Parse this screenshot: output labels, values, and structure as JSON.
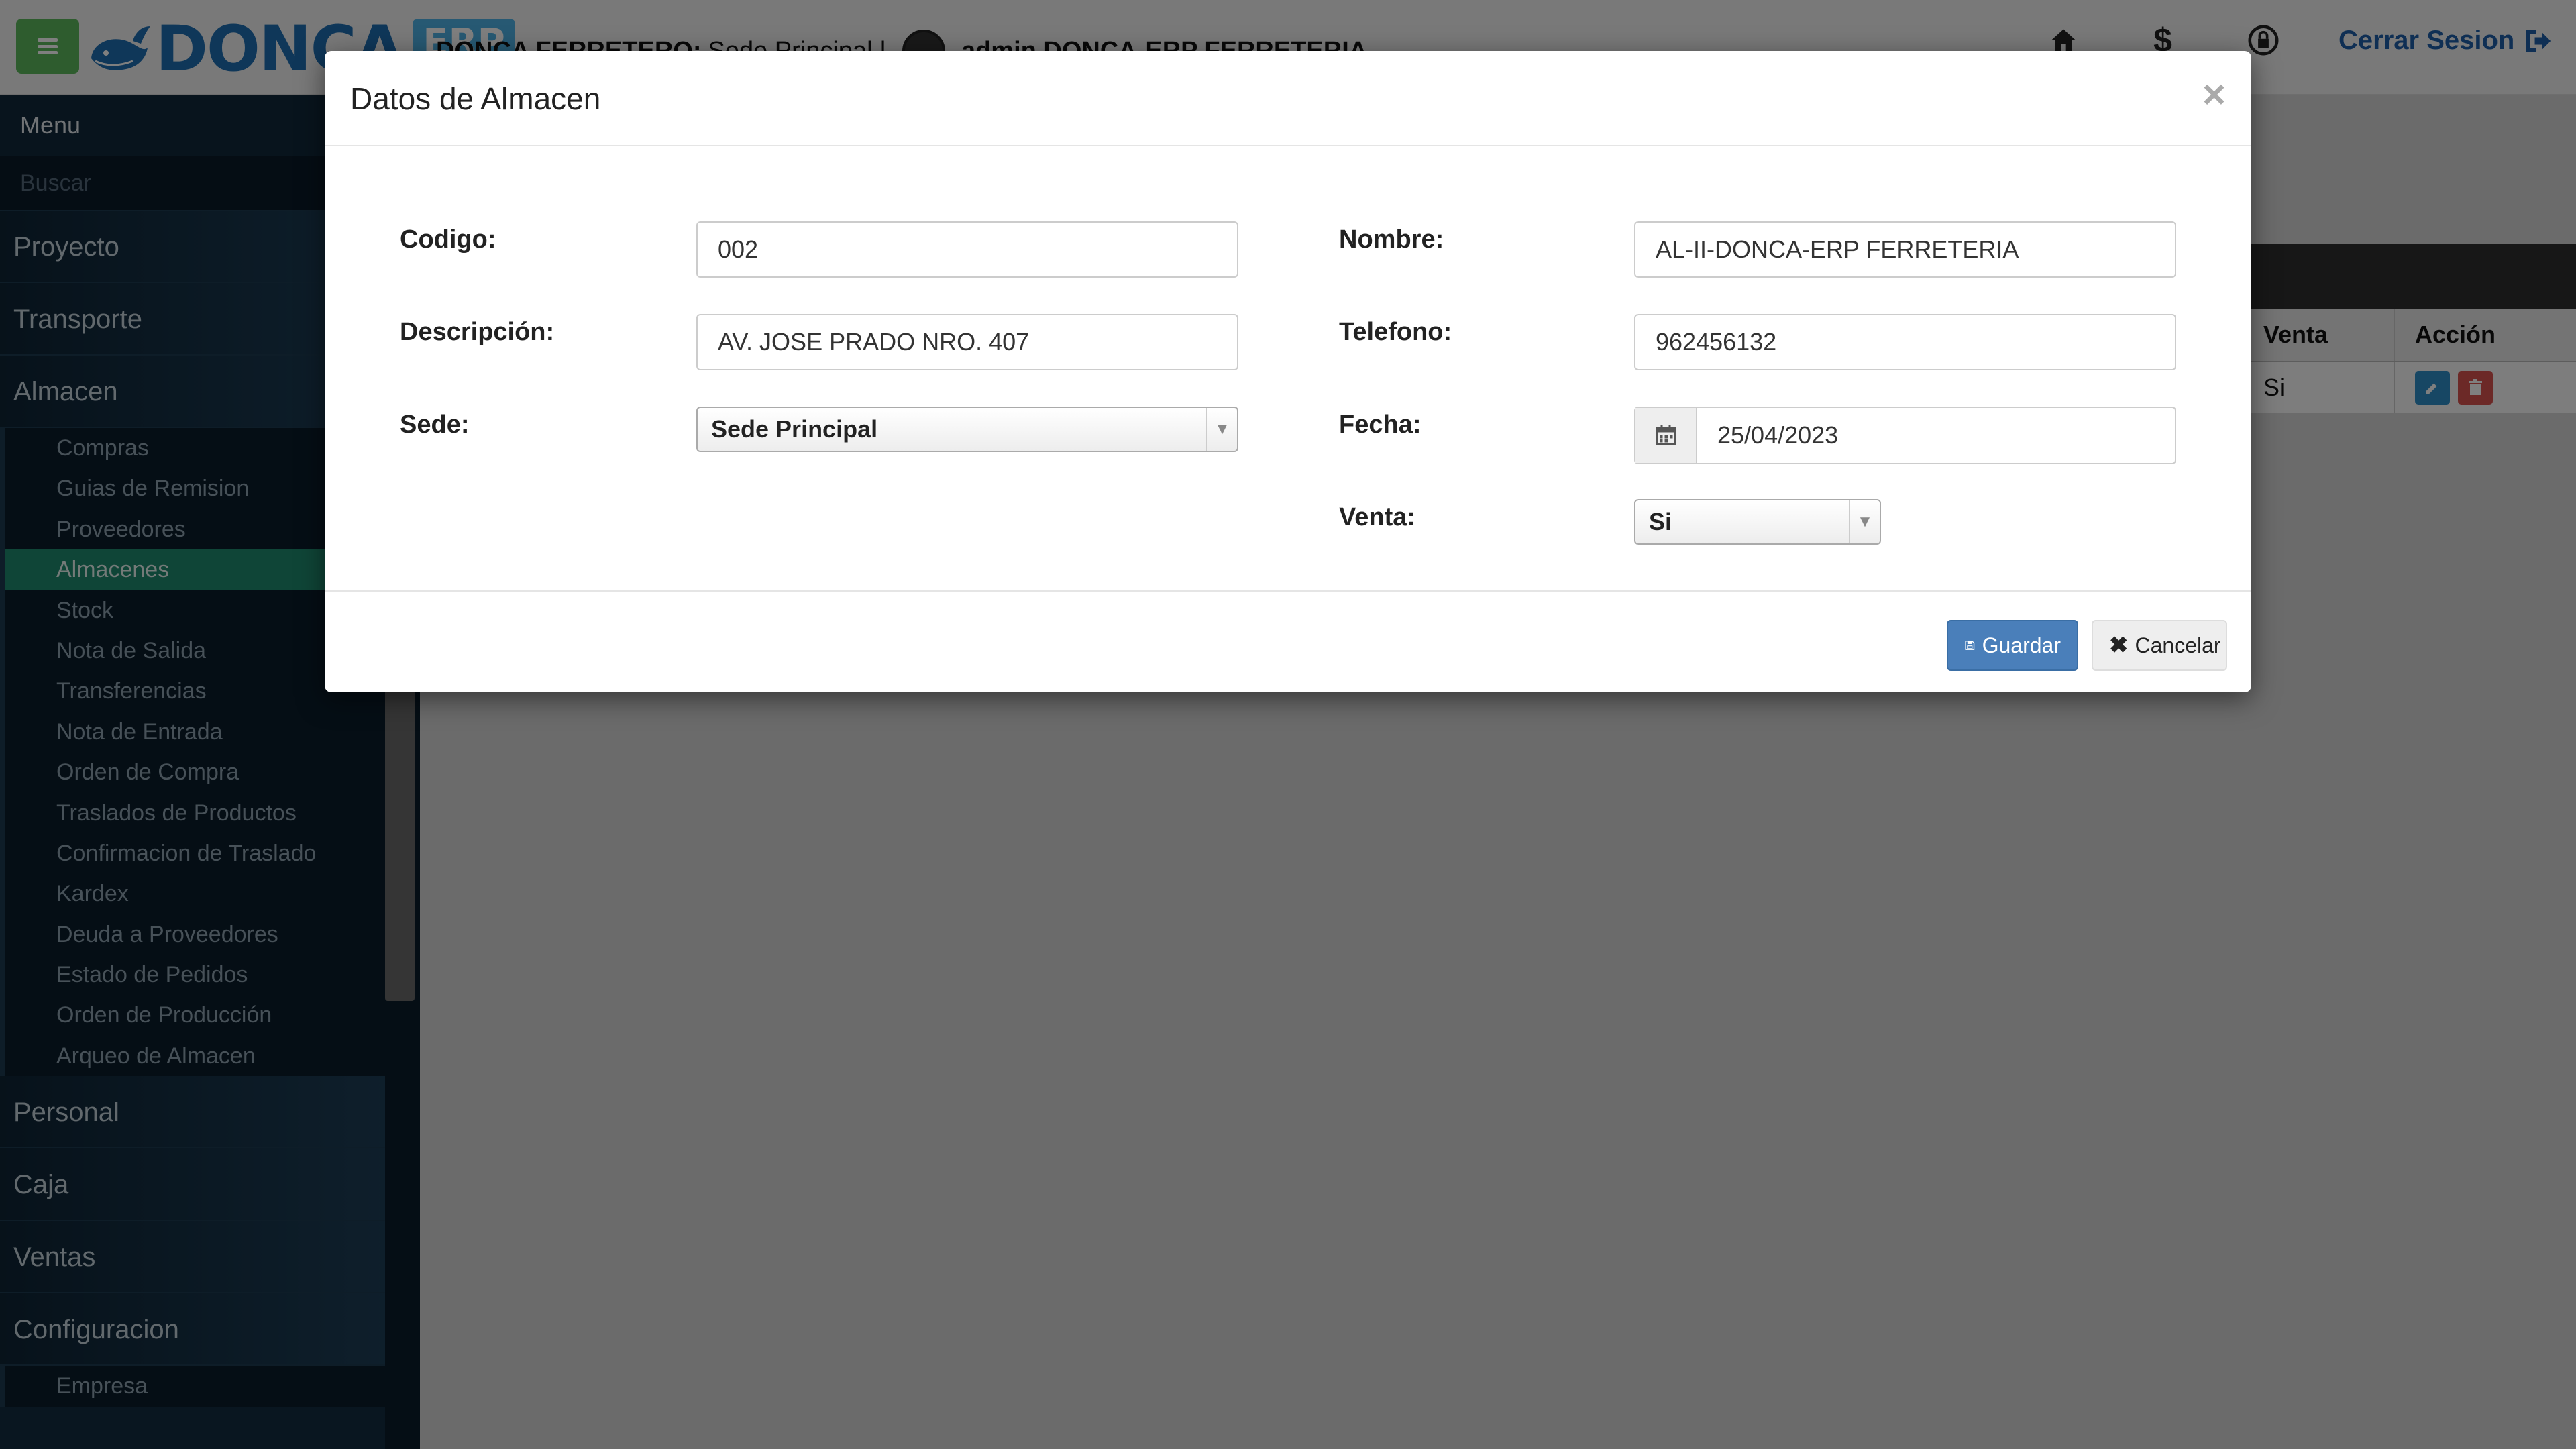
{
  "header": {
    "logo_text": "DONCA",
    "logo_badge": "ERP",
    "company_name": "DONCA FERRETERO:",
    "branch": "Sede Principal |",
    "user": "admin DONCA-ERP FERRETERIA",
    "logout_label": "Cerrar Sesion"
  },
  "sidebar": {
    "title": "Menu",
    "search_placeholder": "Buscar",
    "sections_top": [
      "Proyecto",
      "Transporte",
      "Almacen"
    ],
    "almacen_items": [
      "Compras",
      "Guias de Remision",
      "Proveedores",
      "Almacenes",
      "Stock",
      "Nota de Salida",
      "Transferencias",
      "Nota de Entrada",
      "Orden de Compra",
      "Traslados de Productos",
      "Confirmacion de Traslado",
      "Kardex",
      "Deuda a Proveedores",
      "Estado de Pedidos",
      "Orden de Producción",
      "Arqueo de Almacen"
    ],
    "active_item": "Almacenes",
    "sections_bottom": [
      "Personal",
      "Caja",
      "Ventas",
      "Configuracion"
    ],
    "config_items": [
      "Empresa"
    ]
  },
  "table": {
    "headers": [
      "Venta",
      "Acción"
    ],
    "row": {
      "venta": "Si"
    }
  },
  "modal": {
    "title": "Datos de Almacen",
    "fields": {
      "codigo_label": "Codigo:",
      "codigo_value": "002",
      "nombre_label": "Nombre:",
      "nombre_value": "AL-II-DONCA-ERP FERRETERIA",
      "descripcion_label": "Descripción:",
      "descripcion_value": "AV. JOSE PRADO NRO. 407",
      "telefono_label": "Telefono:",
      "telefono_value": "962456132",
      "sede_label": "Sede:",
      "sede_value": "Sede Principal",
      "fecha_label": "Fecha:",
      "fecha_value": "25/04/2023",
      "venta_label": "Venta:",
      "venta_value": "Si"
    },
    "save_label": "Guardar",
    "cancel_label": "Cancelar"
  },
  "colors": {
    "accent_green": "#5cb85c",
    "active_item": "#1e8a6f",
    "save_button": "#4a7fba",
    "logout_link": "#1f5fa8"
  }
}
